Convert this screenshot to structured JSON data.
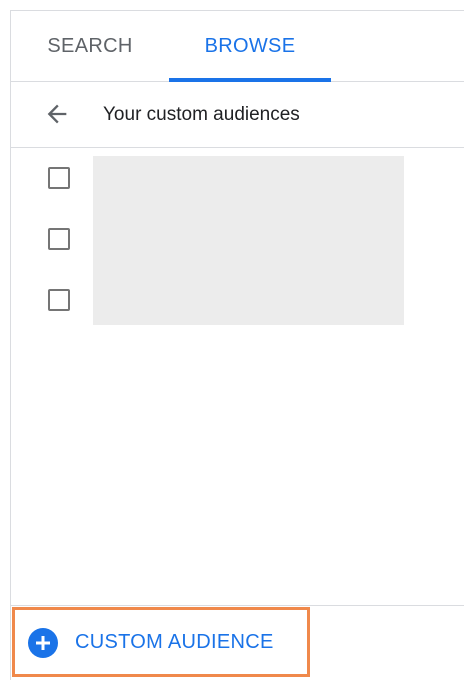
{
  "tabs": [
    {
      "label": "SEARCH",
      "active": false
    },
    {
      "label": "BROWSE",
      "active": true
    }
  ],
  "header": {
    "back_icon": "arrow-back-icon",
    "title": "Your custom audiences"
  },
  "list": {
    "checkboxes": [
      {
        "checked": false
      },
      {
        "checked": false
      },
      {
        "checked": false
      }
    ]
  },
  "footer": {
    "add_icon": "add-circle-icon",
    "button_label": "CUSTOM AUDIENCE"
  },
  "colors": {
    "accent": "#1a73e8",
    "highlight_border": "#f0894b",
    "placeholder": "#ececec"
  }
}
